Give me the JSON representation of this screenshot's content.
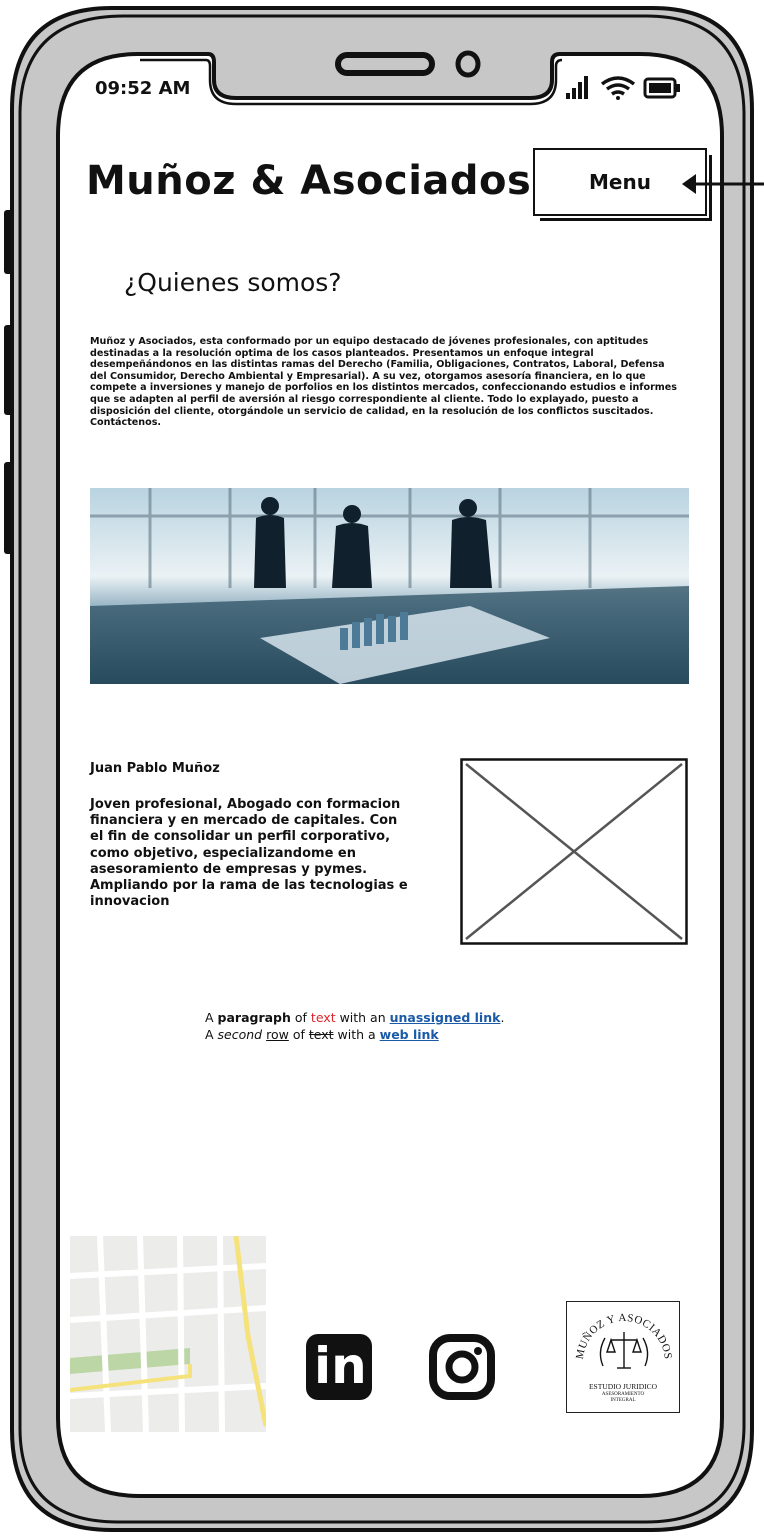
{
  "status_bar": {
    "time": "09:52 AM"
  },
  "header": {
    "title": "Muñoz & Asociados",
    "menu_label": "Menu"
  },
  "about": {
    "heading": "¿Quienes somos?",
    "body": "Muñoz y Asociados, esta conformado por un equipo destacado de jóvenes profesionales, con aptitudes destinadas a la resolución optima de los casos planteados. Presentamos un enfoque integral desempeñándonos en las distintas ramas del Derecho (Familia, Obligaciones, Contratos, Laboral, Defensa del Consumidor, Derecho Ambiental y Empresarial). A su vez, otorgamos asesoría financiera, en lo que compete a inversiones y manejo de porfolios en los distintos mercados, confeccionando estudios e informes que se adapten al perfil de aversión al riesgo correspondiente al cliente. Todo lo explayado, puesto a disposición del cliente, otorgándole un servicio de calidad, en la resolución de los conflictos suscitados. Contáctenos."
  },
  "profile": {
    "name": "Juan Pablo Muñoz",
    "bio": "Joven profesional, Abogado con formacion financiera y en mercado de capitales. Con el fin de consolidar un perfil corporativo, como objetivo, especializandome en asesoramiento de empresas y pymes. Ampliando por la rama de las tecnologias e innovacion"
  },
  "sample_text": {
    "l1_a": "A ",
    "l1_bold": "paragraph",
    "l1_b": " of ",
    "l1_red": "text",
    "l1_c": " with an ",
    "l1_link": "unassigned link",
    "l1_d": ".",
    "l2_a": "A ",
    "l2_italic": "second",
    "l2_b": " ",
    "l2_underline": "row",
    "l2_c": " of ",
    "l2_strike": "text",
    "l2_d": " with a ",
    "l2_link": "web link"
  },
  "footer": {
    "logo_arc": "MUÑOZ Y ASOCIADOS",
    "logo_line1": "ESTUDIO JURIDICO",
    "logo_line2": "ASESORAMIENTO",
    "logo_line3": "INTEGRAL",
    "linkedin_text": "in"
  },
  "icons": {
    "signal": "signal-icon",
    "wifi": "wifi-icon",
    "battery": "battery-icon",
    "linkedin": "linkedin-icon",
    "instagram": "instagram-icon",
    "map": "map-icon"
  },
  "colors": {
    "phone_frame": "#c7c7c7",
    "link": "#1a5aa6",
    "red_text": "#e0262b",
    "map_green": "#bcd6a6",
    "map_yellow": "#f5e27a"
  }
}
